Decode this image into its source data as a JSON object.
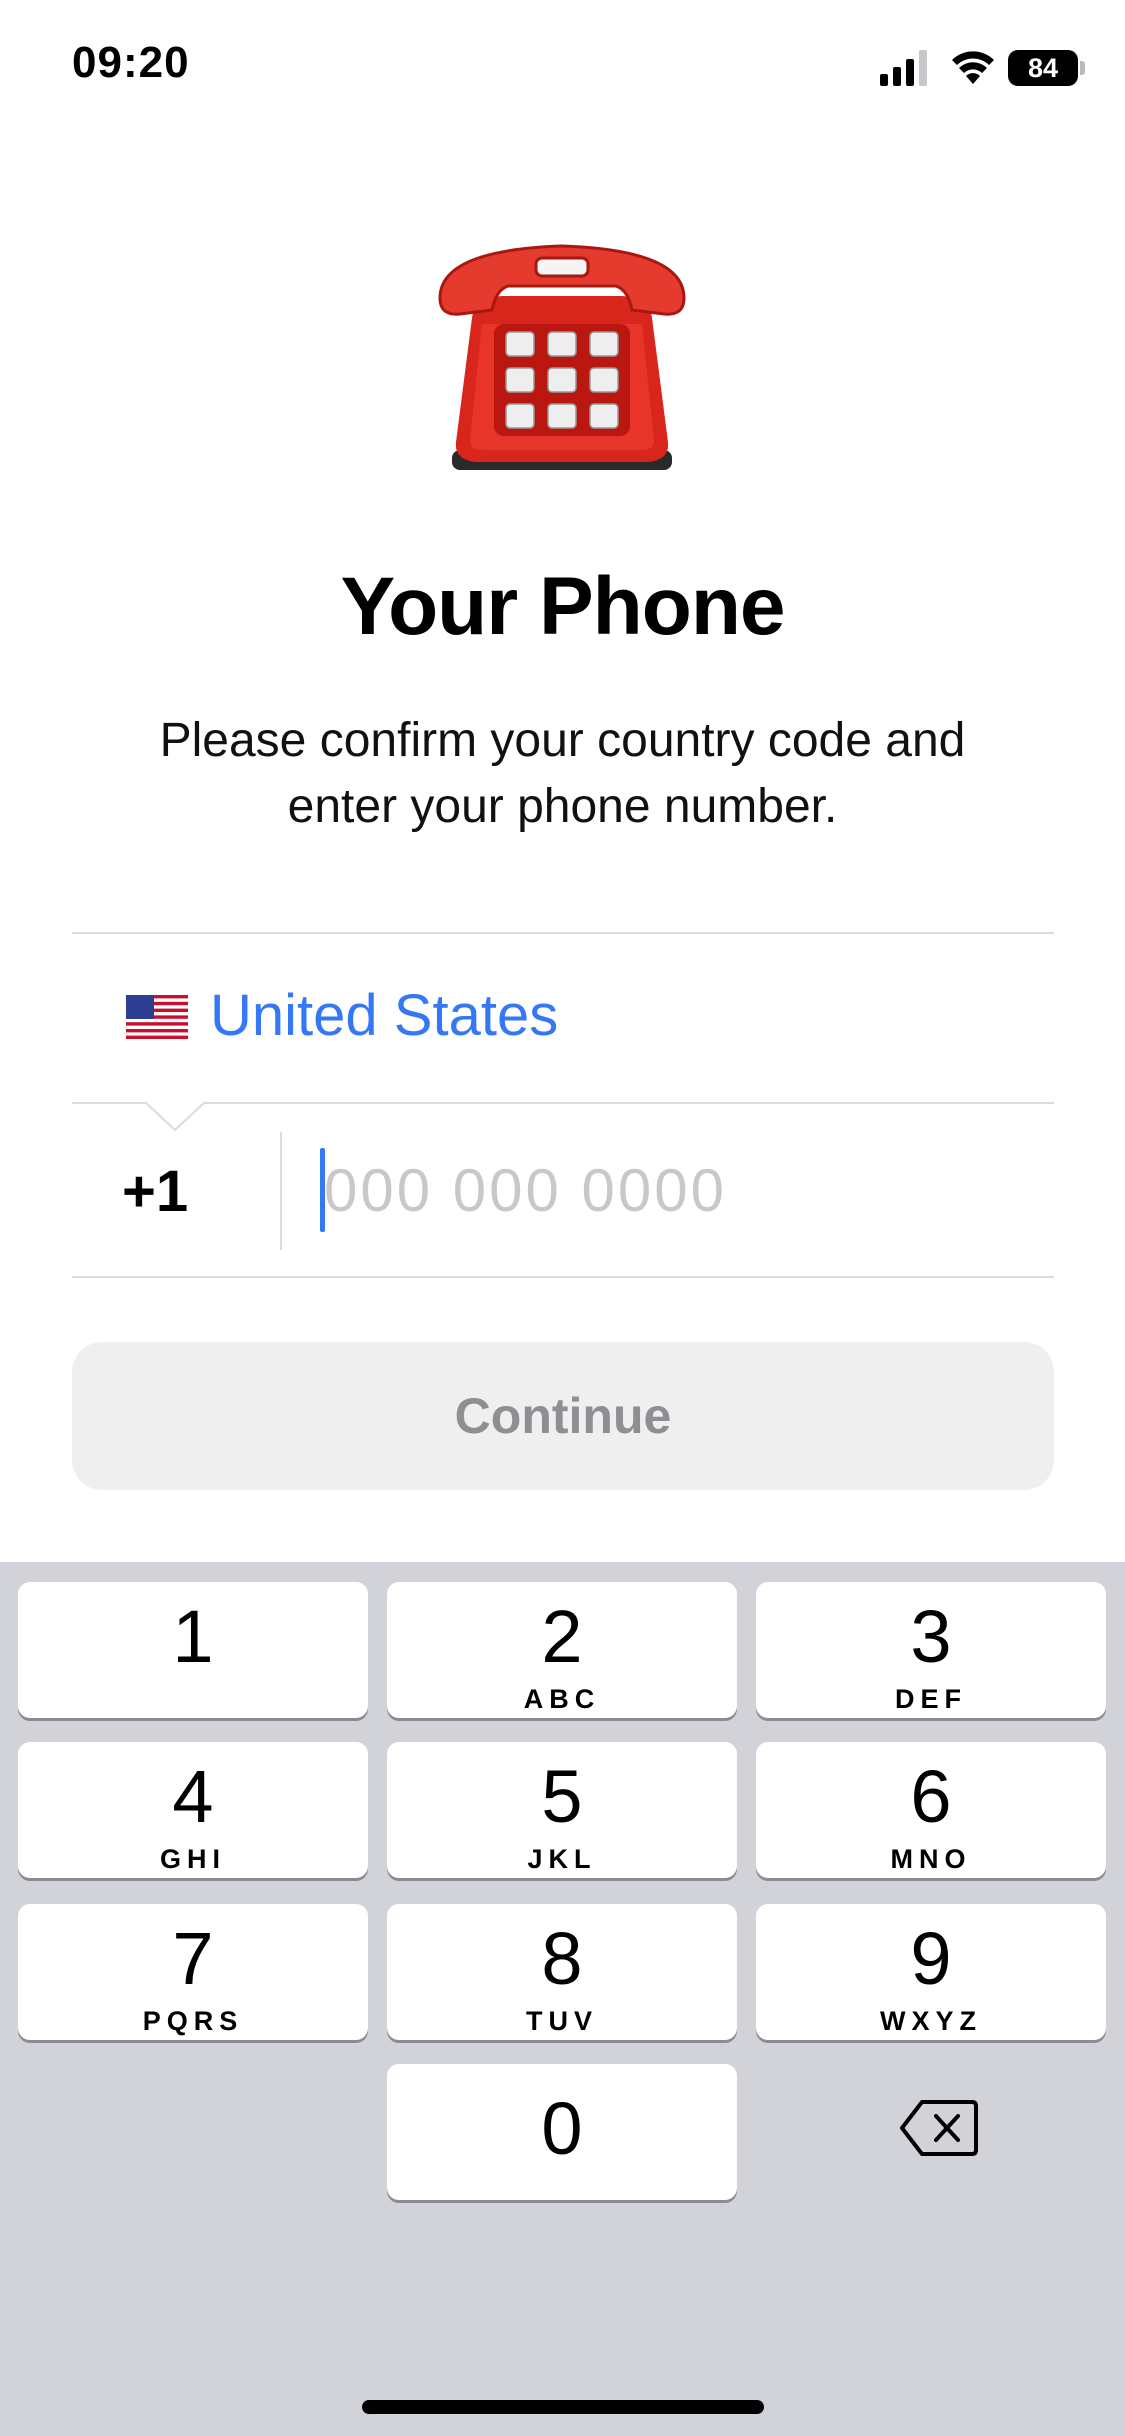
{
  "status_bar": {
    "time": "09:20",
    "battery": "84"
  },
  "hero": {
    "icon": "telephone-icon",
    "title": "Your Phone",
    "subtitle": "Please confirm your country code and enter your phone number."
  },
  "country": {
    "flag": "us-flag-icon",
    "name": "United States"
  },
  "phone": {
    "code": "+1",
    "placeholder": "000 000 0000",
    "value": ""
  },
  "continue_label": "Continue",
  "colors": {
    "accent": "#3478f6",
    "placeholder": "#c8c8cc",
    "button_bg": "#efeff0",
    "keyboard_bg": "#d1d3d9"
  },
  "keypad": [
    {
      "num": "1",
      "letters": ""
    },
    {
      "num": "2",
      "letters": "ABC"
    },
    {
      "num": "3",
      "letters": "DEF"
    },
    {
      "num": "4",
      "letters": "GHI"
    },
    {
      "num": "5",
      "letters": "JKL"
    },
    {
      "num": "6",
      "letters": "MNO"
    },
    {
      "num": "7",
      "letters": "PQRS"
    },
    {
      "num": "8",
      "letters": "TUV"
    },
    {
      "num": "9",
      "letters": "WXYZ"
    },
    {
      "num": "0",
      "letters": ""
    }
  ],
  "backspace_icon": "backspace-icon"
}
